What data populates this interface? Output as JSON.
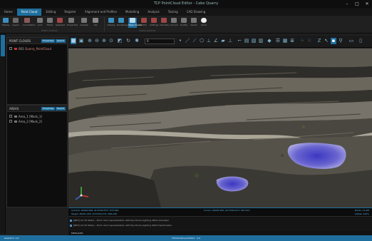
{
  "window": {
    "title": "TCP PointCloud Editor - Cabo Quarry",
    "controls": [
      "–",
      "□",
      "✕"
    ]
  },
  "ribbon": {
    "tabs": [
      "Home",
      "Point Cloud",
      "Editing",
      "Register",
      "Alignment and Profiles",
      "Modelling",
      "Analysis",
      "Tooling",
      "CAD Drawing"
    ],
    "active_tab": "Point Cloud",
    "buttons": [
      "Display",
      "Layers",
      "Colorization",
      "Lock",
      "Filters",
      "Segment",
      "Properties",
      "Classify",
      "Sel",
      "Display",
      "Rendering",
      "Mesh Create",
      "Ortho",
      "Settings",
      "Intensity",
      "Ground",
      "Quality",
      "Select",
      "Cloud"
    ],
    "groups": [
      "POINT CLOUDS",
      "VISUALIZATION"
    ]
  },
  "left_strip": {
    "tab_label": "Workspace"
  },
  "point_clouds_panel": {
    "title": "POINT CLOUDS",
    "badge_left": "Properties",
    "badge_right": "Search",
    "items": [
      {
        "name": "Quarry_PointCloud",
        "id": "001"
      }
    ]
  },
  "areas_panel": {
    "title": "AREAS",
    "badge_left": "Properties",
    "badge_right": "Search",
    "items": [
      {
        "name": "Area_1 [Mask_1]"
      },
      {
        "name": "Area_2 [Mask_2]"
      }
    ]
  },
  "toolbar": {
    "select_value": "0"
  },
  "coords": {
    "camera": "Camera: 46190.608; 4173310.877; 575.509",
    "target": "Target: 46201.244; 4173316.271; 566.228",
    "cursor": "Cursor: 46185.905; 4173310.671; 567.674",
    "right_top": "Points: 12.4M",
    "right_bottom": "Visible: 100%"
  },
  "log": {
    "lines": [
      "[INFO] 12:34 Status - Point cloud representation with Eye Dome Lighting effect Activated",
      "[INFO] 12:34 Status - Point cloud representation with Eye Dome Lighting effect Deactivated"
    ],
    "header": "MESSAGES"
  },
  "statusbar": {
    "left": "Selection: 1/1",
    "center": "TCP PointCloud Editor - 2.0"
  },
  "colors": {
    "accent": "#1f6f9e",
    "mask_fill": "#6a66d6"
  },
  "icons": [
    "grid-icon",
    "select-icon",
    "zoom-in-icon",
    "zoom-out-icon",
    "fit-icon",
    "measure-icon",
    "line-icon",
    "polygon-icon",
    "axes-icon"
  ]
}
